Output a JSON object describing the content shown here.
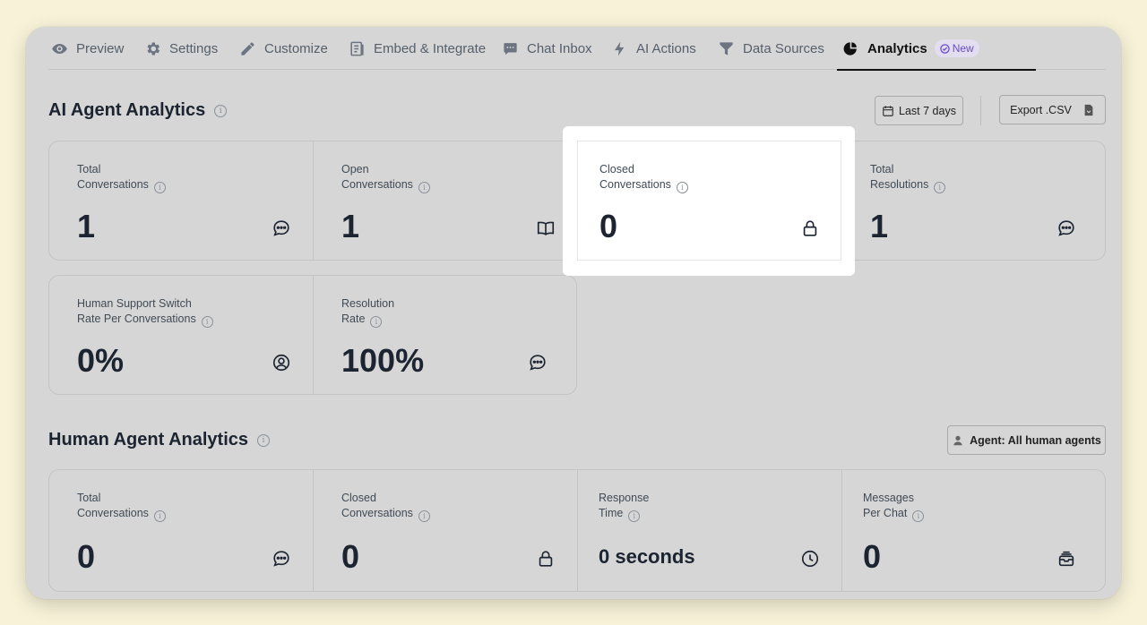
{
  "tabs": [
    {
      "label": "Preview",
      "icon": "eye-icon"
    },
    {
      "label": "Settings",
      "icon": "gear-icon"
    },
    {
      "label": "Customize",
      "icon": "pencil-icon"
    },
    {
      "label": "Embed & Integrate",
      "icon": "code-document-icon"
    },
    {
      "label": "Chat Inbox",
      "icon": "chat-bubble-icon"
    },
    {
      "label": "AI Actions",
      "icon": "lightning-icon"
    },
    {
      "label": "Data Sources",
      "icon": "funnel-icon"
    },
    {
      "label": "Analytics",
      "icon": "pie-chart-icon",
      "active": true,
      "badge": "New"
    }
  ],
  "ai_section": {
    "title": "AI Agent Analytics",
    "date_range_label": "Last 7 days",
    "export_label": "Export .CSV",
    "row1": [
      {
        "label_line1": "Total",
        "label_line2": "Conversations",
        "value": "1",
        "icon": "chat-dots-icon"
      },
      {
        "label_line1": "Open",
        "label_line2": "Conversations",
        "value": "1",
        "icon": "open-book-icon"
      },
      {
        "label_line1": "Closed",
        "label_line2": "Conversations",
        "value": "0",
        "icon": "lock-icon"
      },
      {
        "label_line1": "Total",
        "label_line2": "Resolutions",
        "value": "1",
        "icon": "chat-dots-icon"
      }
    ],
    "row2": [
      {
        "label_line1": "Human Support Switch",
        "label_line2": "Rate Per Conversations",
        "value": "0%",
        "icon": "user-circle-icon"
      },
      {
        "label_line1": "Resolution",
        "label_line2": "Rate",
        "value": "100%",
        "icon": "chat-dots-icon"
      }
    ]
  },
  "human_section": {
    "title": "Human Agent Analytics",
    "agent_filter_label": "Agent: All human agents",
    "row": [
      {
        "label_line1": "Total",
        "label_line2": "Conversations",
        "value": "0",
        "icon": "chat-dots-icon"
      },
      {
        "label_line1": "Closed",
        "label_line2": "Conversations",
        "value": "0",
        "icon": "lock-icon"
      },
      {
        "label_line1": "Response",
        "label_line2": "Time",
        "value": "0 seconds",
        "icon": "clock-icon"
      },
      {
        "label_line1": "Messages",
        "label_line2": "Per Chat",
        "value": "0",
        "icon": "inbox-stack-icon"
      }
    ]
  },
  "colors": {
    "page_bg": "#f7f2d8",
    "panel_bg": "#d6d6d6",
    "badge_text": "#6b4bc7",
    "badge_bg": "#e2def0",
    "highlight": "#ffffff"
  }
}
